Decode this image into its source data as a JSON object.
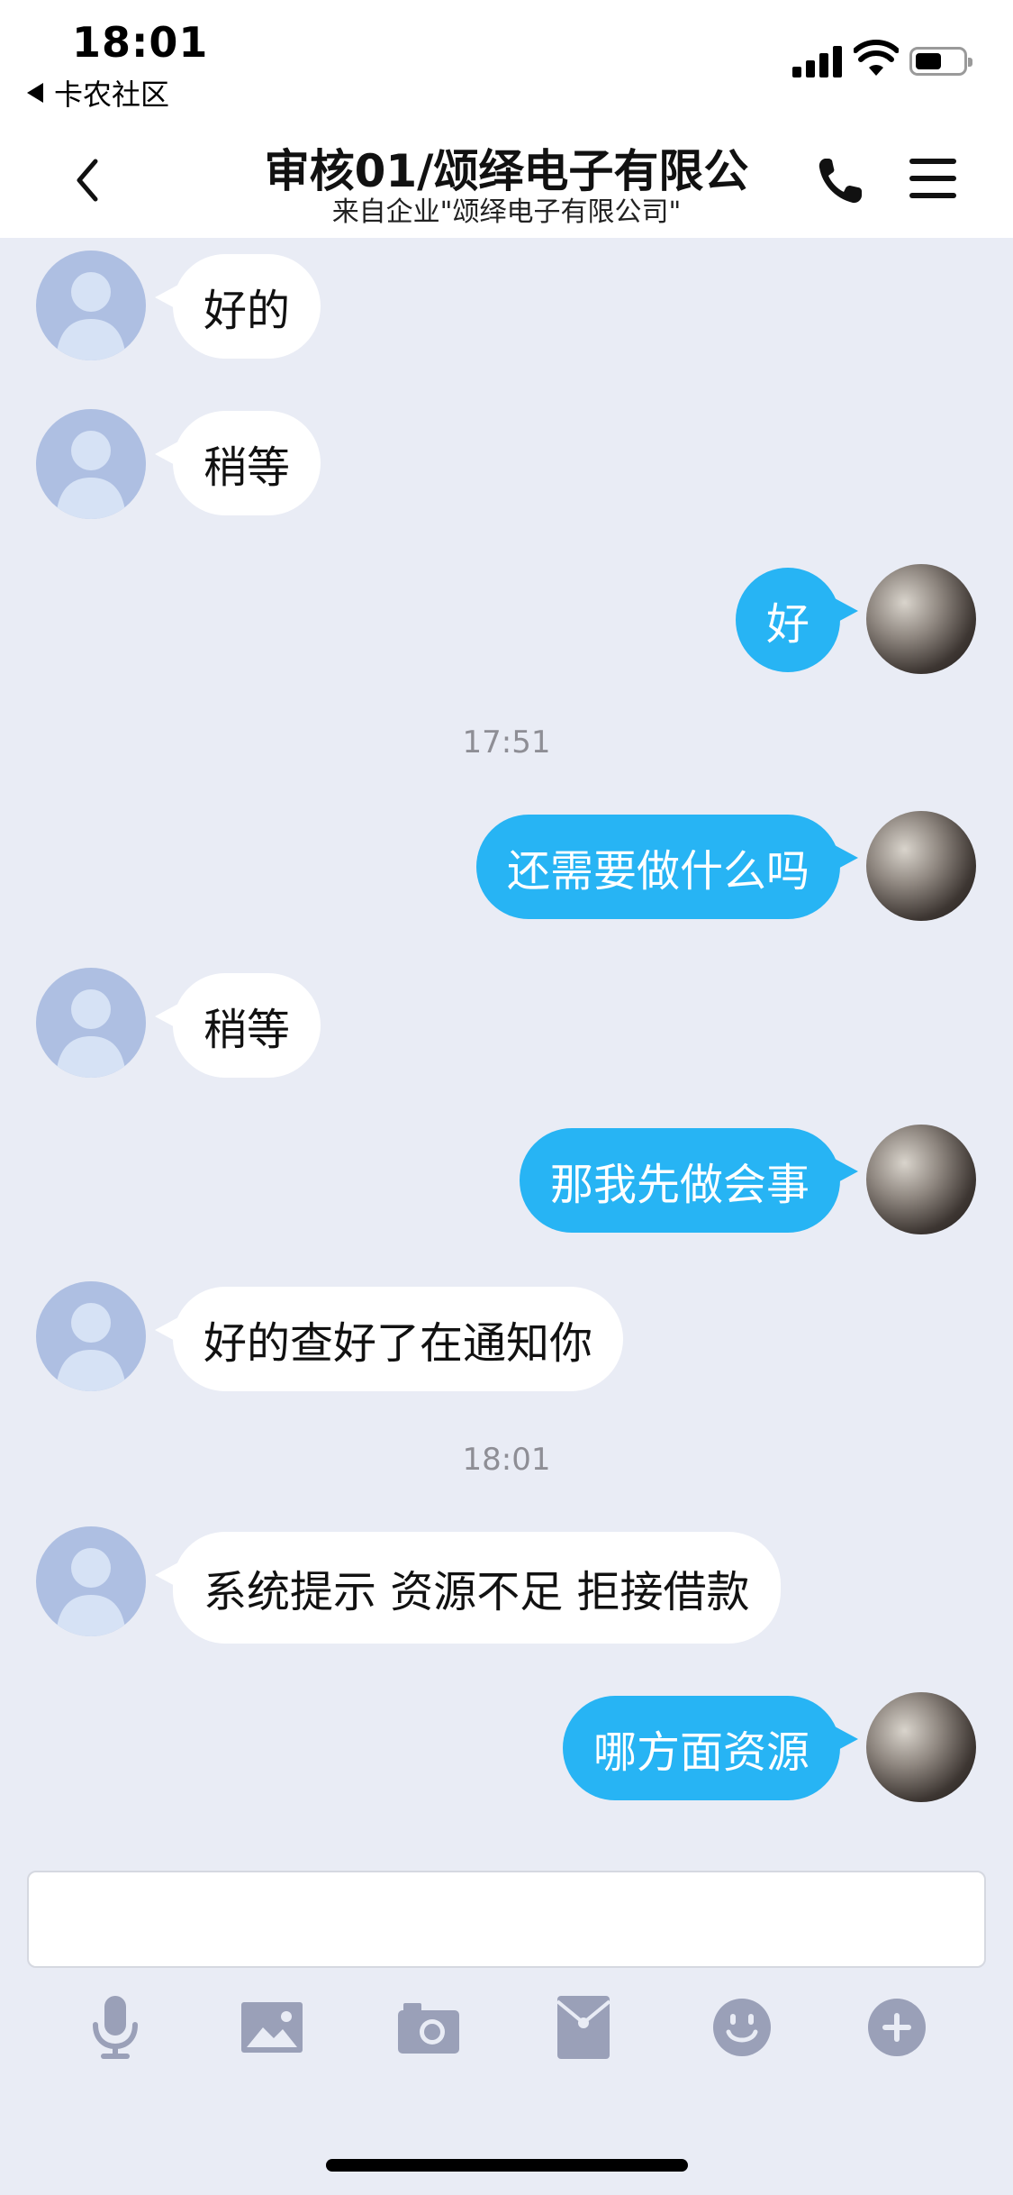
{
  "status_bar": {
    "time": "18:01",
    "back_app": "卡农社区"
  },
  "nav": {
    "title": "审核01/颂绎电子有限公",
    "subtitle": "来自企业\"颂绎电子有限公司\""
  },
  "messages": [
    {
      "dir": "in",
      "text": "好的"
    },
    {
      "dir": "in",
      "text": "稍等"
    },
    {
      "dir": "out",
      "text": "好"
    },
    {
      "timestamp": "17:51"
    },
    {
      "dir": "out",
      "text": "还需要做什么吗"
    },
    {
      "dir": "in",
      "text": "稍等"
    },
    {
      "dir": "out",
      "text": "那我先做会事"
    },
    {
      "dir": "in",
      "text": "好的查好了在通知你"
    },
    {
      "timestamp": "18:01"
    },
    {
      "dir": "in",
      "text": "系统提示 资源不足  拒接借款"
    },
    {
      "dir": "out",
      "text": "哪方面资源"
    }
  ],
  "input": {
    "value": ""
  },
  "toolbar": [
    "microphone-icon",
    "image-icon",
    "camera-icon",
    "red-packet-icon",
    "emoji-icon",
    "plus-icon"
  ],
  "colors": {
    "accent": "#27b4f4",
    "background": "#e9ecf5",
    "avatar_placeholder": "#aebfe2",
    "toolbar_icon": "#9aa0b8"
  }
}
